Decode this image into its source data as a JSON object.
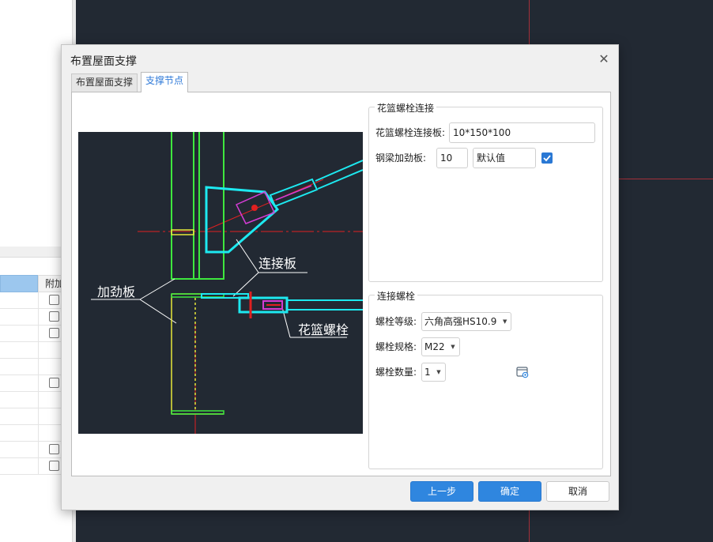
{
  "background": {
    "grid_header": "附加",
    "checkbox_rows": [
      true,
      true,
      true,
      false,
      false,
      true,
      false,
      false,
      false,
      true,
      true
    ]
  },
  "dialog": {
    "title": "布置屋面支撑",
    "close_symbol": "✕",
    "tabs": [
      {
        "label": "布置屋面支撑",
        "active": false
      },
      {
        "label": "支撑节点",
        "active": true
      }
    ]
  },
  "preview": {
    "labels": {
      "stiffener": "加劲板",
      "connection_plate": "连接板",
      "turnbuckle_bolt": "花篮螺栓"
    }
  },
  "turnbuckle_group": {
    "title": "花篮螺栓连接",
    "plate_label": "花篮螺栓连接板:",
    "plate_value": "10*150*100",
    "stiffener_label": "钢梁加劲板:",
    "stiffener_value": "10",
    "default_value": "默认值",
    "default_checked": true
  },
  "bolt_group": {
    "title": "连接螺栓",
    "grade_label": "螺栓等级:",
    "grade_value": "六角高强HS10.9",
    "spec_label": "螺栓规格:",
    "spec_value": "M22",
    "count_label": "螺栓数量:",
    "count_value": "1"
  },
  "buttons": {
    "prev": "上一步",
    "ok": "确定",
    "cancel": "取消"
  },
  "colors": {
    "accent": "#2f86df",
    "cad_background": "#222933",
    "cad_cyan": "#1de9f0",
    "cad_green": "#3ee83e",
    "cad_yellow": "#e8e83a",
    "cad_red": "#e02020",
    "cad_magenta": "#d43cd4"
  }
}
